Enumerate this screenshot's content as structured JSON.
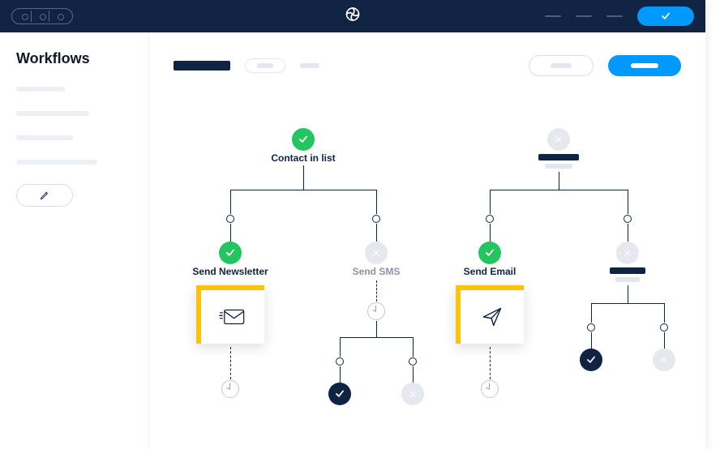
{
  "sidebar": {
    "title": "Workflows"
  },
  "nodes": {
    "root_left": "Contact in list",
    "send_newsletter": "Send Newsletter",
    "send_sms": "Send SMS",
    "send_email": "Send Email"
  },
  "colors": {
    "primary": "#0099ff",
    "navy": "#0f2343",
    "success": "#22c55e",
    "muted": "#e5e8ee",
    "accent": "#ffc20a"
  },
  "icons": {
    "logo": "spiral-logo",
    "confirm": "check-icon",
    "edit": "pencil-icon",
    "mail": "envelope-icon",
    "send": "paper-plane-icon",
    "clock": "clock-icon",
    "close": "close-icon"
  }
}
